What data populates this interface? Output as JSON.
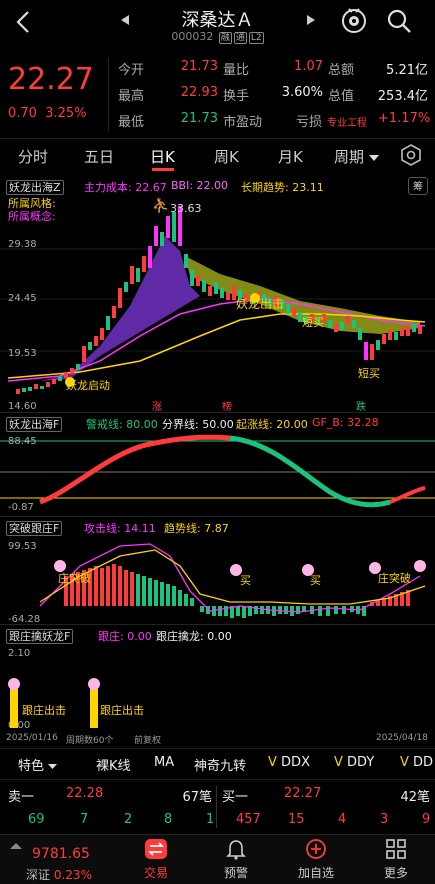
{
  "header": {
    "title": "深桑达Ａ",
    "code": "000032",
    "tags": [
      "融",
      "通",
      "L2"
    ]
  },
  "quote": {
    "price": "22.27",
    "change": "0.70",
    "change_pct": "3.25%",
    "rows": [
      {
        "l1": "今开",
        "v1": "21.73",
        "l2": "量比",
        "v2": "1.07",
        "l3": "总额",
        "v3": "5.21亿"
      },
      {
        "l1": "最高",
        "v1": "22.93",
        "l2": "换手",
        "v2": "3.60%",
        "l3": "总值",
        "v3": "253.4亿"
      },
      {
        "l1": "最低",
        "v1": "21.73",
        "l2": "市盈动",
        "v2": "",
        "l3": "亏损",
        "v3": "专业工程",
        "v4": "+1.17%"
      }
    ]
  },
  "tabs": [
    "分时",
    "五日",
    "日K",
    "周K",
    "月K",
    "周期"
  ],
  "chart1": {
    "name": "妖龙出海Z",
    "labels": [
      "主力成本: 22.67",
      "BBI: 22.00",
      "长期趋势: 23.11"
    ],
    "note_btn": "筹",
    "lines": [
      "所属风格:",
      "所属概念:"
    ],
    "yticks": [
      "29.38",
      "24.45",
      "19.53",
      "14.60"
    ],
    "peak": "33.63",
    "annotations": [
      "妖龙出击",
      "短买",
      "短买",
      "妖龙启动"
    ],
    "markers": [
      "涨",
      "榜",
      "跌"
    ]
  },
  "chart2": {
    "name": "妖龙出海F",
    "labels": [
      "警戒线: 80.00",
      "分界线: 50.00",
      "起涨线: 20.00",
      "GF_B: 32.28"
    ],
    "yticks": [
      "88.45",
      "-0.87"
    ]
  },
  "chart3": {
    "name": "突破跟庄F",
    "labels": [
      "攻击线: 14.11",
      "趋势线: 7.87"
    ],
    "yticks": [
      "99.53",
      "-64.28"
    ],
    "annotations": [
      "庄突破",
      "买",
      "买",
      "庄突破"
    ]
  },
  "chart4": {
    "name": "跟庄擒妖龙F",
    "labels": [
      "跟庄: 0.00",
      "跟庄擒龙: 0.00"
    ],
    "yticks": [
      "2.10",
      "0.00"
    ],
    "annotations": [
      "跟庄出击",
      "跟庄出击"
    ]
  },
  "axis": {
    "start": "2025/01/16",
    "period": "周期数60个",
    "adjust": "前复权",
    "end": "2025/04/18"
  },
  "indicator_tabs": [
    "特色",
    "裸K线",
    "MA",
    "神奇九转",
    "DDX",
    "DDY",
    "DD"
  ],
  "orderbook": {
    "sell_label": "卖一",
    "sell_price": "22.28",
    "sell_qty": "67笔",
    "buy_label": "买一",
    "buy_price": "22.27",
    "buy_qty": "42笔",
    "sell_counts": [
      "69",
      "7",
      "2",
      "8",
      "1"
    ],
    "buy_counts": [
      "457",
      "15",
      "4",
      "3",
      "9"
    ]
  },
  "footer": {
    "index_value": "9781.65",
    "index_name": "深证",
    "index_pct": "0.23%",
    "items": [
      "交易",
      "预警",
      "加自选",
      "更多"
    ]
  },
  "colors": {
    "up": "#ff3b3b",
    "down": "#19c37d",
    "accent": "#ffd400",
    "line2": "#ff33ff"
  }
}
